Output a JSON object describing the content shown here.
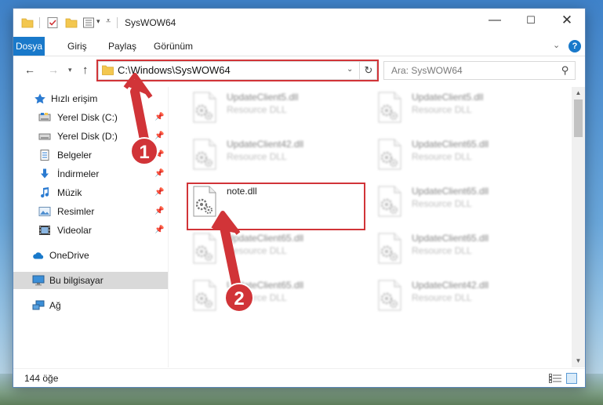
{
  "window": {
    "title": "SysWOW64",
    "controls": {
      "minimize": "—",
      "maximize": "☐",
      "close": "✕"
    }
  },
  "ribbon": {
    "tabs": [
      "Dosya",
      "Giriş",
      "Paylaş",
      "Görünüm"
    ],
    "help": "?"
  },
  "address": {
    "path": "C:\\Windows\\SysWOW64",
    "highlight_color": "#d13438"
  },
  "search": {
    "placeholder": "Ara: SysWOW64"
  },
  "sidebar": {
    "items": [
      {
        "label": "Hızlı erişim",
        "icon": "star-icon"
      },
      {
        "label": "Yerel Disk (C:)",
        "icon": "drive-icon",
        "pinned": true
      },
      {
        "label": "Yerel Disk (D:)",
        "icon": "drive-icon",
        "pinned": true
      },
      {
        "label": "Belgeler",
        "icon": "documents-icon",
        "pinned": true
      },
      {
        "label": "İndirmeler",
        "icon": "download-icon",
        "pinned": true
      },
      {
        "label": "Müzik",
        "icon": "music-icon",
        "pinned": true
      },
      {
        "label": "Resimler",
        "icon": "pictures-icon",
        "pinned": true
      },
      {
        "label": "Videolar",
        "icon": "video-icon",
        "pinned": true
      },
      {
        "label": "OneDrive",
        "icon": "cloud-icon"
      },
      {
        "label": "Bu bilgisayar",
        "icon": "computer-icon",
        "selected": true
      },
      {
        "label": "Ağ",
        "icon": "network-icon"
      }
    ]
  },
  "files": {
    "left": [
      {
        "name": "UpdateClient5.dll",
        "type": "Resource DLL"
      },
      {
        "name": "UpdateClient42.dll",
        "type": "Resource DLL"
      },
      {
        "name": "note.dll",
        "type": ""
      },
      {
        "name": "UpdateClient65.dll",
        "type": "Resource DLL"
      },
      {
        "name": "UpdateClient65.dll",
        "type": "Resource DLL"
      }
    ],
    "right": [
      {
        "name": "UpdateClient5.dll",
        "type": "Resource DLL"
      },
      {
        "name": "UpdateClient65.dll",
        "type": "Resource DLL"
      },
      {
        "name": "UpdateClient65.dll",
        "type": "Resource DLL"
      },
      {
        "name": "UpdateClient65.dll",
        "type": "Resource DLL"
      },
      {
        "name": "UpdateClient42.dll",
        "type": "Resource DLL"
      }
    ]
  },
  "status": {
    "item_count": "144 öğe"
  },
  "annotations": {
    "badge1": "1",
    "badge2": "2",
    "color": "#d13438"
  },
  "colors": {
    "accent": "#1979ca",
    "selection": "#d9d9d9"
  }
}
